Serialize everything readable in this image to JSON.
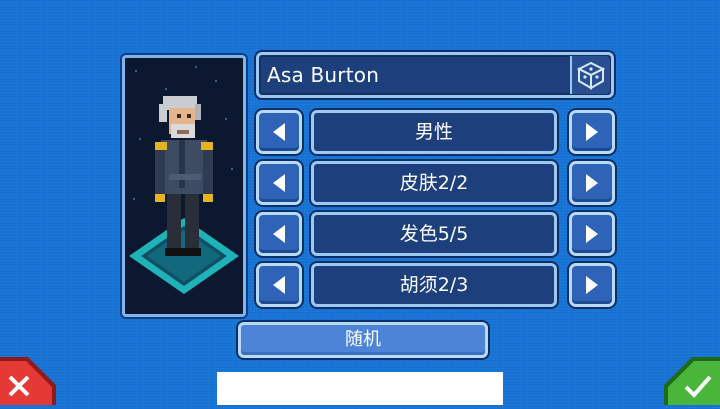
{
  "character": {
    "name": "Asa Burton"
  },
  "options": [
    {
      "label": "男性"
    },
    {
      "label": "皮肤2/2"
    },
    {
      "label": "发色5/5"
    },
    {
      "label": "胡须2/3"
    }
  ],
  "random_label": "随机",
  "colors": {
    "background": "#1774d6",
    "panel": "#1d3f7c",
    "border": "#9cc8f2",
    "cancel": "#e53935",
    "confirm": "#49b63b"
  },
  "icons": {
    "dice": "dice-icon",
    "left": "arrow-left-icon",
    "right": "arrow-right-icon",
    "cancel": "close-icon",
    "confirm": "check-icon"
  }
}
